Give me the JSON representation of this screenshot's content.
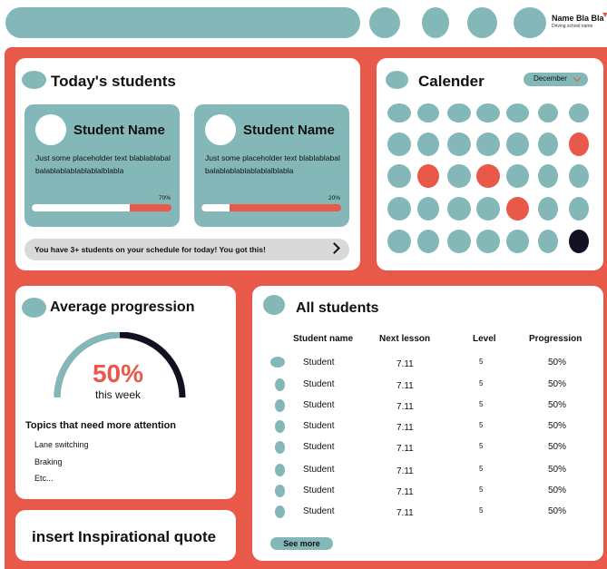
{
  "header": {
    "user_name": "Name Bla Bla",
    "user_subtitle": "Driving school name"
  },
  "today": {
    "title": "Today's students",
    "students": [
      {
        "name": "Student Name",
        "description": "Just some placeholder text blablablabalbalablablablablablalblabla",
        "progress_label": "70%",
        "progress": 0.7
      },
      {
        "name": "Student Name",
        "description": "Just some placeholder text blablablabalbalablablablablablalblabla",
        "progress_label": "20%",
        "progress": 0.2
      }
    ],
    "banner": "You have 3+ students on your schedule for today! You got this!"
  },
  "calendar": {
    "title": "Calender",
    "month": "December",
    "colors": {
      "default": "#84b8b8",
      "marked": "#e8594a",
      "today": "#111122"
    },
    "weeks": [
      [
        "default",
        "default",
        "default",
        "default",
        "default",
        "default",
        "default"
      ],
      [
        "default",
        "default",
        "default",
        "default",
        "default",
        "default",
        "marked"
      ],
      [
        "default",
        "marked",
        "default",
        "marked",
        "default",
        "default",
        "default"
      ],
      [
        "default",
        "default",
        "default",
        "default",
        "marked",
        "default",
        "default"
      ],
      [
        "default",
        "default",
        "default",
        "default",
        "default",
        "default",
        "today"
      ]
    ]
  },
  "progression": {
    "title": "Average progression",
    "value_label": "50%",
    "value": 0.5,
    "period": "this week",
    "topics_title": "Topics that need more attention",
    "topics": [
      "Lane switching",
      "Braking",
      "Etc..."
    ]
  },
  "quote": {
    "text": "insert Inspirational quote"
  },
  "students": {
    "title": "All students",
    "columns": [
      "Student name",
      "Next lesson",
      "Level",
      "Progression"
    ],
    "rows": [
      {
        "name": "Student",
        "next_lesson": "7.11",
        "level": "5",
        "progression": "50%"
      },
      {
        "name": "Student",
        "next_lesson": "7.11",
        "level": "5",
        "progression": "50%"
      },
      {
        "name": "Student",
        "next_lesson": "7.11",
        "level": "5",
        "progression": "50%"
      },
      {
        "name": "Student",
        "next_lesson": "7.11",
        "level": "5",
        "progression": "50%"
      },
      {
        "name": "Student",
        "next_lesson": "7.11",
        "level": "5",
        "progression": "50%"
      },
      {
        "name": "Student",
        "next_lesson": "7.11",
        "level": "5",
        "progression": "50%"
      },
      {
        "name": "Student",
        "next_lesson": "7.11",
        "level": "5",
        "progression": "50%"
      },
      {
        "name": "Student",
        "next_lesson": "7.11",
        "level": "5",
        "progression": "50%"
      }
    ],
    "see_more": "See more"
  }
}
